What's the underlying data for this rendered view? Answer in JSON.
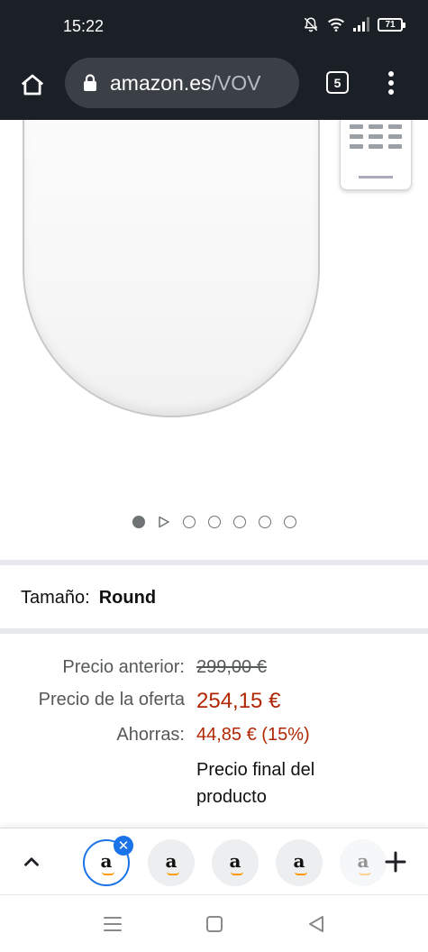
{
  "status_bar": {
    "time": "15:22",
    "battery": "71",
    "icons": [
      "bell-off-icon",
      "wifi-icon",
      "signal-icon",
      "battery-icon"
    ]
  },
  "browser": {
    "url_domain": "amazon.es",
    "url_path": "/VOV",
    "tab_count": "5",
    "icons": [
      "home-icon",
      "lock-icon",
      "tab-switcher-icon",
      "more-vert-icon"
    ]
  },
  "gallery": {
    "image_count": 7,
    "active_index": 0,
    "has_video_indicator": true
  },
  "product": {
    "size_label": "Tamaño:",
    "size_value": "Round"
  },
  "pricing": {
    "old_price_label": "Precio anterior:",
    "old_price": "299,00 €",
    "deal_price_label": "Precio de la oferta",
    "deal_price": "254,15 €",
    "savings_label": "Ahorras:",
    "savings": "44,85 € (15%)",
    "final_note": "Precio final del producto"
  },
  "colors": {
    "status_bg": "#1b1f26",
    "price_red": "#b12704",
    "tab_active_blue": "#1a73e8",
    "amazon_orange": "#ff9900"
  },
  "tab_strip": {
    "tab_letter": "a",
    "tabs": 5,
    "icons": [
      "chevron-up-icon",
      "close-icon",
      "plus-icon"
    ]
  },
  "system_nav": {
    "icons": [
      "menu-icon",
      "home-square-icon",
      "back-triangle-icon"
    ]
  }
}
